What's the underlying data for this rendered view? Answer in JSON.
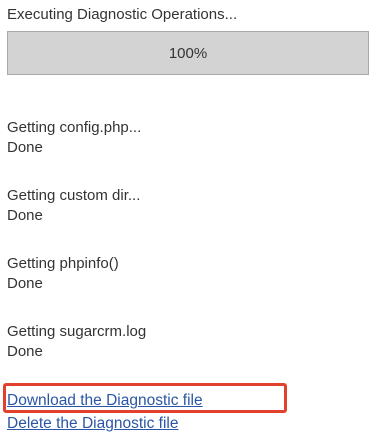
{
  "heading": "Executing Diagnostic Operations...",
  "progress": {
    "percent_label": "100%",
    "fraction": 1.0
  },
  "steps": [
    {
      "label": "Getting config.php...",
      "status": "Done"
    },
    {
      "label": "Getting custom dir...",
      "status": "Done"
    },
    {
      "label": "Getting phpinfo()",
      "status": "Done"
    },
    {
      "label": "Getting sugarcrm.log",
      "status": "Done"
    }
  ],
  "links": {
    "download": "Download the Diagnostic file",
    "delete": "Delete the Diagnostic file"
  },
  "colors": {
    "link": "#2a56a5",
    "highlight": "#e2412e"
  }
}
